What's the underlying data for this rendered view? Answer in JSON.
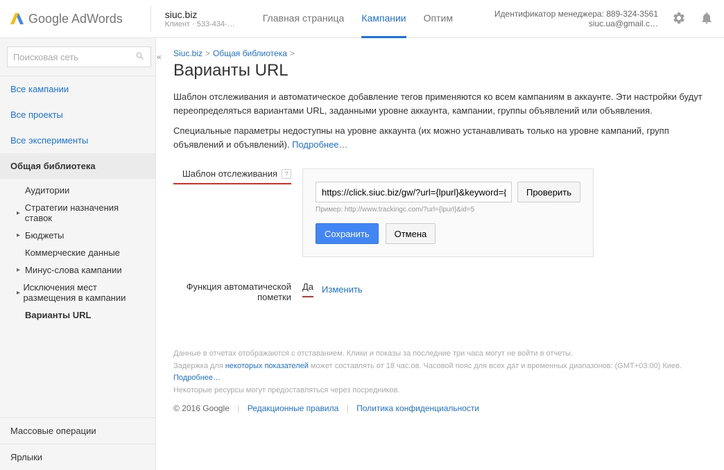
{
  "header": {
    "logo_text": "Google AdWords",
    "client_domain": "siuc.biz",
    "client_sub": "Клиент · 533-434-…",
    "tabs": {
      "home": "Главная страница",
      "campaigns": "Кампании",
      "optim": "Оптим"
    },
    "manager_id_label": "Идентификатор менеджера: 889-324-3561",
    "manager_email": "siuc.ua@gmail.c…"
  },
  "sidebar": {
    "search_placeholder": "Поисковая сеть",
    "all_campaigns": "Все кампании",
    "all_projects": "Все проекты",
    "all_experiments": "Все эксперименты",
    "shared_library": "Общая библиотека",
    "items": {
      "audiences": "Аудитории",
      "bid_strategies": "Стратегии назначения ставок",
      "budgets": "Бюджеты",
      "commercial_data": "Коммерческие данные",
      "neg_keywords": "Минус-слова кампании",
      "placement_exclusions": "Исключения мест размещения в кампании",
      "url_options": "Варианты URL"
    },
    "bulk_ops": "Массовые операции",
    "labels": "Ярлыки"
  },
  "content": {
    "crumb1": "Siuc.biz",
    "crumb2": "Общая библиотека",
    "title": "Варианты URL",
    "desc1": "Шаблон отслеживания и автоматическое добавление тегов применяются ко всем кампаниям в аккаунте. Эти настройки будут переопределяться вариантами URL, заданными уровне аккаунта, кампании, группы объявлений или объявления.",
    "desc2_a": "Специальные параметры недоступны на уровне аккаунта (их можно устанавливать только на уровне кампаний, групп объявлений и объявлений). ",
    "desc2_link": "Подробнее…",
    "tracking_template_label": "Шаблон отслеживания",
    "url_input_value": "https://click.siuc.biz/gw/?url={lpurl}&keyword={keyw",
    "verify_btn": "Проверить",
    "example_hint": "Пример: http://www.trackingc.com/?url={lpurl}&id=5",
    "save_btn": "Сохранить",
    "cancel_btn": "Отмена",
    "auto_tagging_label": "Функция автоматической пометки",
    "auto_tagging_value": "Да",
    "change_link": "Изменить",
    "footer_note1": "Данные в отчетах отображаются с отставанием. Клики и показы за последние три часа могут не войти в отчеты.",
    "footer_note2_a": "Задержка для ",
    "footer_note2_link": "некоторых показателей",
    "footer_note2_b": " может составлять от 18 час.ов. Часовой пояс для всех дат и временных диапазонов: (GMT+03:00) Киев.",
    "footer_note3_link": "Подробнее…",
    "footer_note4": "Некоторые ресурсы могут предоставляться через посредников.",
    "copyright": "© 2016 Google",
    "editorial_link": "Редакционные правила",
    "privacy_link": "Политика конфиденциальности"
  }
}
